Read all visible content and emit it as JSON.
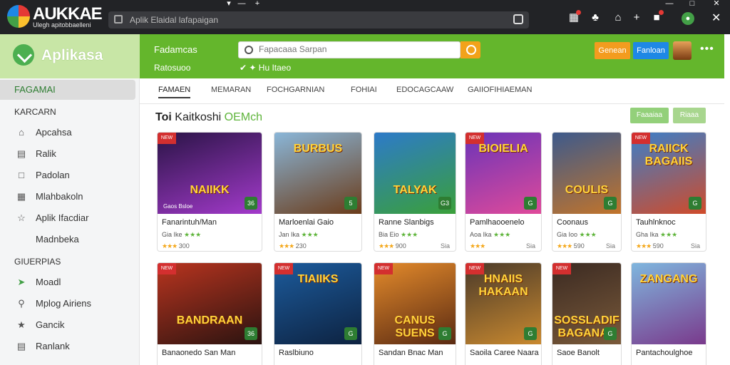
{
  "app": {
    "brand": "AUKKAE",
    "brand_sub": "Ulegh apitobbaelleni",
    "url": "Aplik Elaidal lafapaigan"
  },
  "sidebar": {
    "title": "Aplikasa",
    "active_item": "FAGAMAI",
    "section1": "KARCARN",
    "items1": [
      {
        "label": "Apcahsa",
        "icon": "home-icon"
      },
      {
        "label": "Ralik",
        "icon": "chart-icon"
      },
      {
        "label": "Padolan",
        "icon": "folder-icon"
      },
      {
        "label": "Mlahbakoln",
        "icon": "tag-icon"
      },
      {
        "label": "Aplik Ifacdiar",
        "icon": "star-icon"
      },
      {
        "label": "Madnbeka",
        "icon": "book-icon"
      }
    ],
    "section2": "GIUERPIAS",
    "items2": [
      {
        "label": "Moadl",
        "icon": "gamepad-icon"
      },
      {
        "label": "Mplog Airiens",
        "icon": "search-icon"
      },
      {
        "label": "Gancik",
        "icon": "star-icon"
      },
      {
        "label": "Ranlank",
        "icon": "book-icon"
      }
    ]
  },
  "header": {
    "line1": "Fadamcas",
    "line2": "Ratosuoo",
    "line3": "✔ ✦ Hu Itaeo",
    "search_placeholder": "Fapacaaa Sarpan",
    "btn_orange": "Genean",
    "btn_blue": "Fanloan"
  },
  "tabs": [
    "FAMAEN",
    "MEMARAN",
    "FOCHGARNIAN",
    "FOHIAI",
    "EDOCAGCAAW",
    "GAIIOFIHIAEMAN"
  ],
  "section": {
    "title_dark": "Toi",
    "title_mid": "Kaitkoshi",
    "title_light": "OEMch",
    "btn1": "Faaaiaa",
    "btn2": "Riaaa"
  },
  "cards": [
    {
      "art": "NAIIKK",
      "ribbon": "NEW",
      "caption": "Gaos Bsloe",
      "badge": "36",
      "title": "Fanarintuh/Man",
      "sub": "Gia Ike",
      "rating_text": "300",
      "extra": "",
      "colors": [
        "#2a1446",
        "#a33acb"
      ]
    },
    {
      "art": "BURBUS",
      "ribbon": "",
      "caption": "",
      "badge": "5",
      "title": "Marloenlai Gaio",
      "sub": "Jan Ika",
      "rating_text": "230",
      "extra": "",
      "colors": [
        "#8ab6d8",
        "#6b3c1a"
      ]
    },
    {
      "art": "TALYAK",
      "ribbon": "",
      "caption": "",
      "badge": "G3",
      "title": "Ranne Slanbigs",
      "sub": "Bia Eio",
      "rating_text": "900",
      "extra": "Sia",
      "colors": [
        "#2d7ac9",
        "#3aa03a"
      ]
    },
    {
      "art": "BIOIELIA",
      "ribbon": "NEW",
      "caption": "",
      "badge": "G",
      "title": "Pamlhaooenelo",
      "sub": "Aoa Ika",
      "rating_text": "",
      "extra": "Sia",
      "colors": [
        "#6a34b8",
        "#e04a9a"
      ]
    },
    {
      "art": "COULIS",
      "ribbon": "",
      "caption": "",
      "badge": "G",
      "title": "Coonaus",
      "sub": "Gia Ioo",
      "rating_text": "590",
      "extra": "Sia",
      "colors": [
        "#3d5a8c",
        "#c2742a"
      ]
    },
    {
      "art": "RAIICK BAGAIIS",
      "ribbon": "NEW",
      "caption": "",
      "badge": "G",
      "title": "Tauhlnknoc",
      "sub": "Gha Ika",
      "rating_text": "590",
      "extra": "Sia",
      "colors": [
        "#3b7fc9",
        "#d04b2a"
      ]
    },
    {
      "art": "BANDRAAN",
      "ribbon": "NEW",
      "caption": "",
      "badge": "36",
      "title": "Banaonedo San Man",
      "sub": "",
      "rating_text": "",
      "extra": "",
      "colors": [
        "#b8341f",
        "#2a1310"
      ]
    },
    {
      "art": "TIAIIKS",
      "ribbon": "NEW",
      "caption": "",
      "badge": "G",
      "title": "Raslbiuno",
      "sub": "",
      "rating_text": "",
      "extra": "",
      "colors": [
        "#1c5b9c",
        "#0d2240"
      ]
    },
    {
      "art": "CANUS SUENS",
      "ribbon": "NEW",
      "caption": "",
      "badge": "G",
      "title": "Sandan Bnac Man",
      "sub": "",
      "rating_text": "",
      "extra": "",
      "colors": [
        "#e38a2b",
        "#5a2a12"
      ]
    },
    {
      "art": "HNAIIS HAKAAN",
      "ribbon": "NEW",
      "caption": "",
      "badge": "G",
      "title": "Saoila Caree Naara",
      "sub": "",
      "rating_text": "",
      "extra": "",
      "colors": [
        "#4a3a2a",
        "#c9892f"
      ]
    },
    {
      "art": "SOSSLADIF BAGANAS",
      "ribbon": "NEW",
      "caption": "",
      "badge": "G",
      "title": "Saoe Banolt",
      "sub": "",
      "rating_text": "",
      "extra": "",
      "colors": [
        "#3b2a22",
        "#7a5a3a"
      ]
    },
    {
      "art": "ZANGANG",
      "ribbon": "",
      "caption": "",
      "badge": "",
      "title": "Pantachoulghoe",
      "sub": "",
      "rating_text": "",
      "extra": "",
      "colors": [
        "#7fb6de",
        "#7a3a8c"
      ]
    }
  ]
}
